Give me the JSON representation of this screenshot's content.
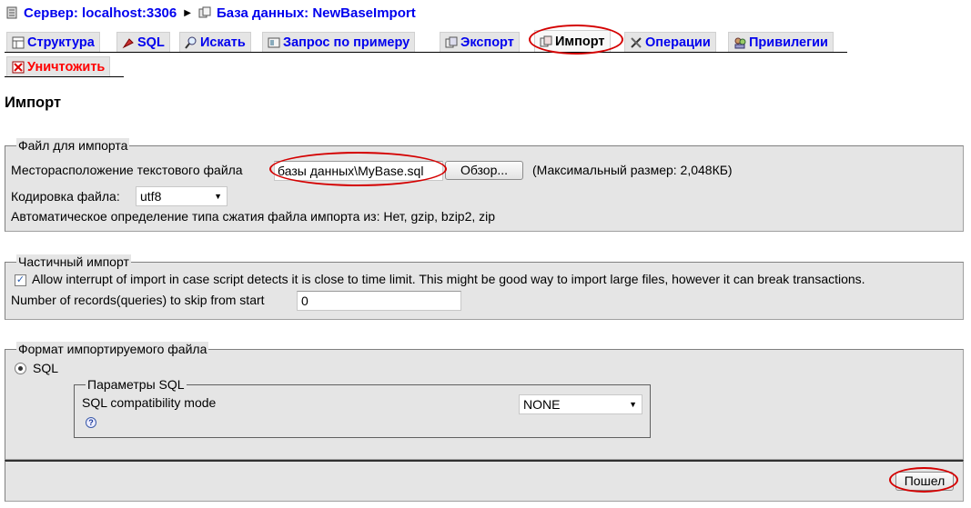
{
  "breadcrumb": {
    "server": "Сервер: localhost:3306",
    "database": "База данных: NewBaseImport"
  },
  "tabs": [
    {
      "label": "Структура",
      "icon": "structure-icon"
    },
    {
      "label": "SQL",
      "icon": "sql-icon"
    },
    {
      "label": "Искать",
      "icon": "search-icon"
    },
    {
      "label": "Запрос по примеру",
      "icon": "query-icon"
    },
    {
      "label": "Экспорт",
      "icon": "export-icon"
    },
    {
      "label": "Импорт",
      "icon": "import-icon",
      "active": true
    },
    {
      "label": "Операции",
      "icon": "operations-icon"
    },
    {
      "label": "Привилегии",
      "icon": "privileges-icon"
    },
    {
      "label": "Уничтожить",
      "icon": "drop-icon"
    }
  ],
  "page_title": "Импорт",
  "import_file": {
    "legend": "Файл для импорта",
    "location_label": "Месторасположение текстового файла",
    "file_value": "базы данных\\MyBase.sql",
    "browse_label": "Обзор...",
    "max_size": "(Максимальный размер: 2,048КБ)",
    "charset_label": "Кодировка файла:",
    "charset_value": "utf8",
    "compression_note": "Автоматическое определение типа сжатия файла импорта из: Нет, gzip, bzip2, zip"
  },
  "partial_import": {
    "legend": "Частичный импорт",
    "allow_interrupt_label": "Allow interrupt of import in case script detects it is close to time limit. This might be good way to import large files, however it can break transactions.",
    "allow_interrupt_checked": true,
    "skip_label": "Number of records(queries) to skip from start",
    "skip_value": "0"
  },
  "format": {
    "legend": "Формат импортируемого файла",
    "option_sql": "SQL",
    "sql_options": {
      "legend": "Параметры SQL",
      "compat_label": "SQL compatibility mode",
      "compat_value": "NONE"
    }
  },
  "submit_label": "Пошел",
  "colors": {
    "link": "#0000ee",
    "drop": "#ff0000",
    "panel": "#e5e5e5",
    "highlight": "#d40000"
  }
}
